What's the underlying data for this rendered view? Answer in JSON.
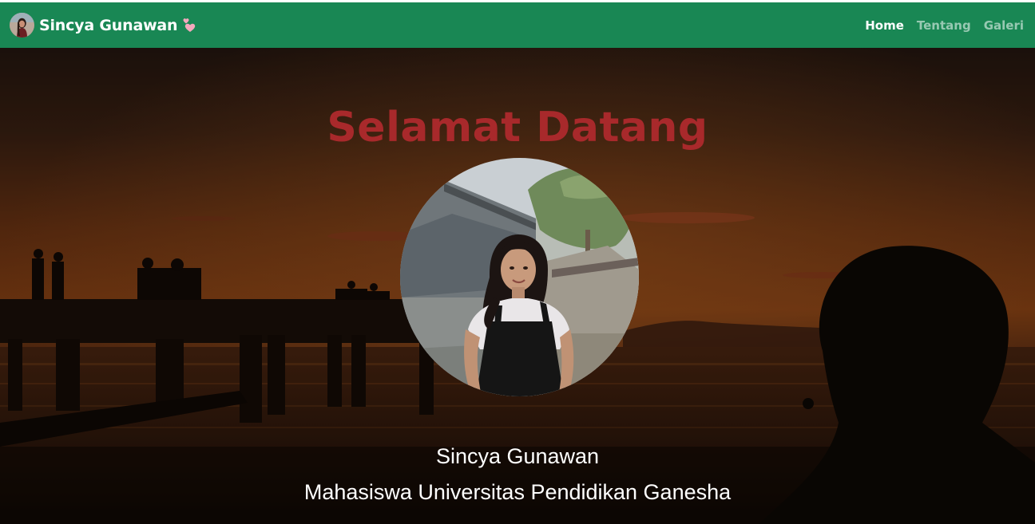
{
  "navbar": {
    "brand_name": "Sincya Gunawan",
    "brand_avatar_icon": "profile-avatar",
    "brand_heart_icon": "two-hearts-icon",
    "links": [
      {
        "label": "Home",
        "active": true
      },
      {
        "label": "Tentang",
        "active": false
      },
      {
        "label": "Galeri",
        "active": false
      }
    ],
    "background_color": "#198754"
  },
  "hero": {
    "title": "Selamat Datang",
    "title_color": "#a8292b",
    "name": "Sincya Gunawan",
    "subtitle": "Mahasiswa Universitas Pendidikan Ganesha",
    "background": "sunset-pier-silhouette-photo",
    "profile_photo": "profile-photo-woman"
  }
}
